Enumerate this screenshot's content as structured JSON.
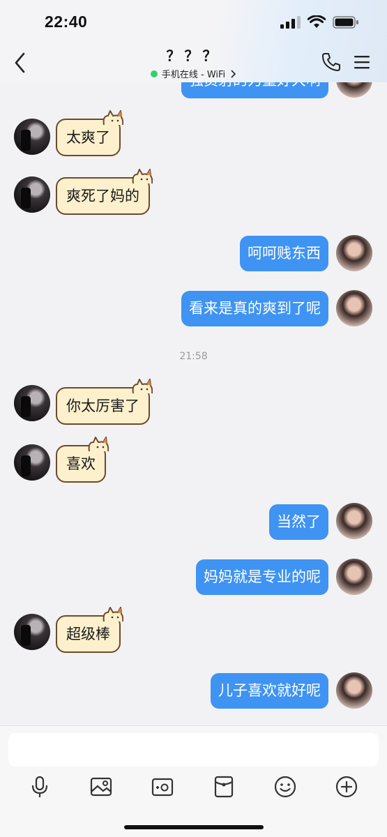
{
  "status_bar": {
    "time": "22:40"
  },
  "header": {
    "title": "？？？",
    "subtitle": "手机在线 - WiFi",
    "online_color": "#33d16a"
  },
  "colors": {
    "outgoing_bubble": "#3f93f2",
    "incoming_bubble": "#fcf0cd",
    "incoming_border": "#6b4a2b"
  },
  "messages": [
    {
      "side": "out",
      "text": "强员射的力量好大啊",
      "partial": true
    },
    {
      "side": "in",
      "text": "太爽了"
    },
    {
      "side": "in",
      "text": "爽死了妈的"
    },
    {
      "side": "out",
      "text": "呵呵贱东西"
    },
    {
      "side": "out",
      "text": "看来是真的爽到了呢"
    },
    {
      "side": "time",
      "text": "21:58"
    },
    {
      "side": "in",
      "text": "你太厉害了"
    },
    {
      "side": "in",
      "text": "喜欢"
    },
    {
      "side": "out",
      "text": "当然了"
    },
    {
      "side": "out",
      "text": "妈妈就是专业的呢"
    },
    {
      "side": "in",
      "text": "超级棒"
    },
    {
      "side": "out",
      "text": "儿子喜欢就好呢"
    }
  ],
  "input": {
    "value": "",
    "placeholder": ""
  },
  "toolbar": [
    "microphone-icon",
    "image-icon",
    "camera-icon",
    "red-envelope-icon",
    "emoji-icon",
    "plus-icon"
  ]
}
